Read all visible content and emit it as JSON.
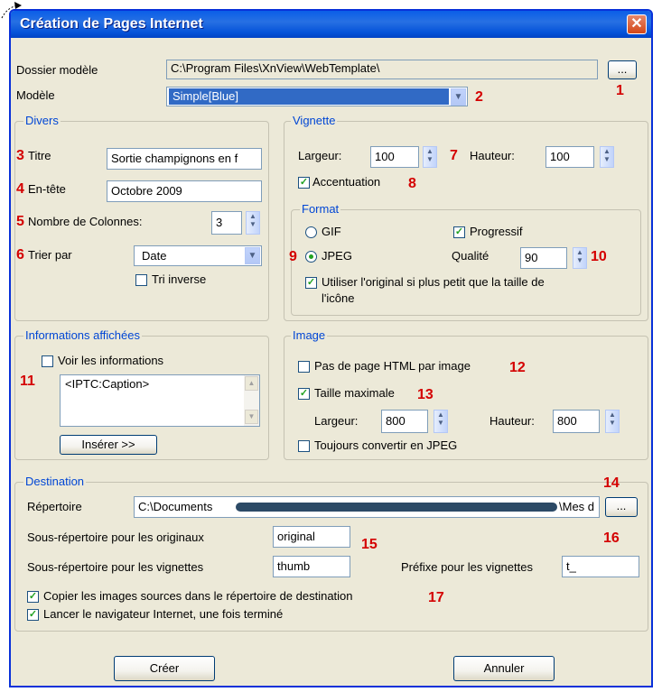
{
  "window": {
    "title": "Création de Pages Internet"
  },
  "template_folder": {
    "label": "Dossier modèle",
    "value": "C:\\Program Files\\XnView\\WebTemplate\\",
    "browse_label": "..."
  },
  "model": {
    "label": "Modèle",
    "value": "Simple[Blue]"
  },
  "divers": {
    "legend": "Divers",
    "title_label": "Titre",
    "title_value": "Sortie champignons en f",
    "header_label": "En-tête",
    "header_value": "Octobre 2009",
    "columns_label": "Nombre de Colonnes:",
    "columns_value": "3",
    "sort_label": "Trier par",
    "sort_value": "Date",
    "reverse_label": "Tri inverse"
  },
  "vignette": {
    "legend": "Vignette",
    "width_label": "Largeur:",
    "width_value": "100",
    "height_label": "Hauteur:",
    "height_value": "100",
    "accent_label": "Accentuation",
    "format_legend": "Format",
    "gif_label": "GIF",
    "jpeg_label": "JPEG",
    "progressive_label": "Progressif",
    "quality_label": "Qualité",
    "quality_value": "90",
    "use_original_line1": "Utiliser l'original si plus petit que la taille de",
    "use_original_line2": "l'icône"
  },
  "infos": {
    "legend": "Informations affichées",
    "show_label": "Voir les informations",
    "text": "<IPTC:Caption>",
    "insert_label": "Insérer >>"
  },
  "image": {
    "legend": "Image",
    "no_html_label": "Pas de page HTML par image",
    "max_size_label": "Taille maximale",
    "width_label": "Largeur:",
    "width_value": "800",
    "height_label": "Hauteur:",
    "height_value": "800",
    "convert_label": "Toujours convertir en JPEG"
  },
  "destination": {
    "legend": "Destination",
    "dir_label": "Répertoire",
    "dir_value_start": "C:\\Documents",
    "dir_value_end": "\\Mes d",
    "browse_label": "...",
    "originals_label": "Sous-répertoire pour les originaux",
    "originals_value": "original",
    "thumbs_label": "Sous-répertoire pour les vignettes",
    "thumbs_value": "thumb",
    "prefix_label": "Préfixe pour les vignettes",
    "prefix_value": "t_",
    "copy_label": "Copier les images sources dans le répertoire de destination",
    "launch_label": "Lancer le navigateur Internet, une fois terminé"
  },
  "buttons": {
    "create_label": "Créer",
    "cancel_label": "Annuler"
  },
  "annotations": [
    "1",
    "2",
    "3",
    "4",
    "5",
    "6",
    "7",
    "8",
    "9",
    "10",
    "11",
    "12",
    "13",
    "14",
    "15",
    "16",
    "17"
  ],
  "colors": {
    "accent": "#0046d5",
    "annotation": "#d40000",
    "titlebar": "#0a5ee8",
    "dialog_bg": "#ece9d8"
  }
}
